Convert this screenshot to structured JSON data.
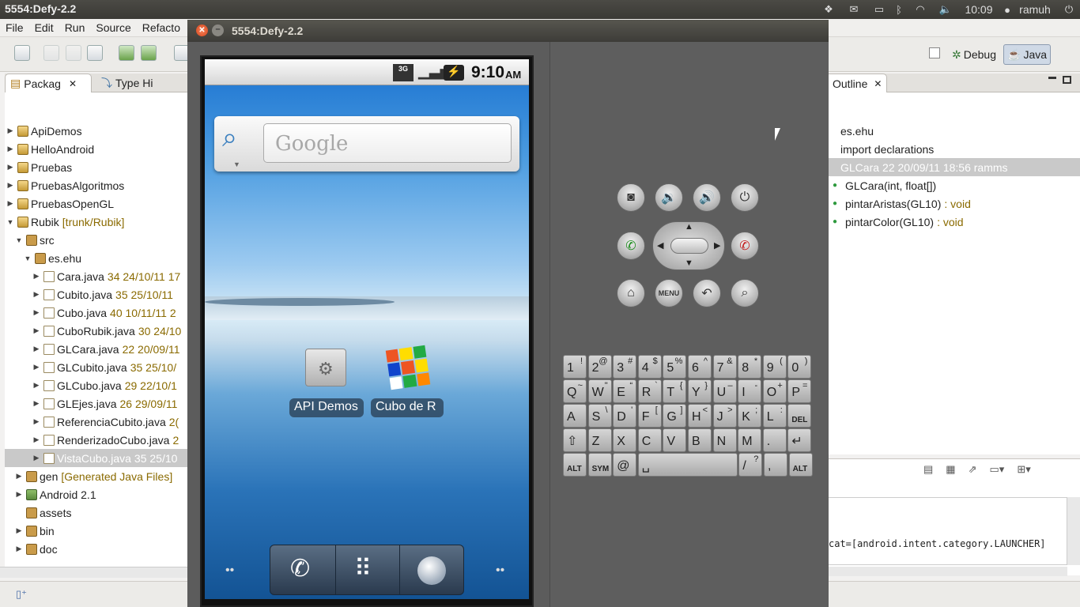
{
  "top_panel": {
    "window_title": "5554:Defy-2.2",
    "clock": "10:09",
    "user": "ramuh"
  },
  "menubar": {
    "items": [
      "File",
      "Edit",
      "Run",
      "Source",
      "Refacto"
    ]
  },
  "perspectives": {
    "debug": "Debug",
    "java": "Java"
  },
  "left_tabs": {
    "package": "Packag",
    "type_hierarchy": "Type Hi"
  },
  "package_tree": {
    "rows": [
      {
        "label": "ApiDemos",
        "deco": ""
      },
      {
        "label": "HelloAndroid",
        "deco": ""
      },
      {
        "label": "Pruebas",
        "deco": ""
      },
      {
        "label": "PruebasAlgoritmos",
        "deco": ""
      },
      {
        "label": "PruebasOpenGL",
        "deco": ""
      },
      {
        "label": "Rubik",
        "deco": "[trunk/Rubik]"
      },
      {
        "label": "src",
        "deco": ""
      },
      {
        "label": "es.ehu",
        "deco": ""
      },
      {
        "label": "Cara.java",
        "deco": "34  24/10/11 17"
      },
      {
        "label": "Cubito.java",
        "deco": "35  25/10/11"
      },
      {
        "label": "Cubo.java",
        "deco": "40  10/11/11 2"
      },
      {
        "label": "CuboRubik.java",
        "deco": "30  24/10"
      },
      {
        "label": "GLCara.java",
        "deco": "22  20/09/11"
      },
      {
        "label": "GLCubito.java",
        "deco": "35  25/10/"
      },
      {
        "label": "GLCubo.java",
        "deco": "29  22/10/1"
      },
      {
        "label": "GLEjes.java",
        "deco": "26  29/09/11"
      },
      {
        "label": "ReferenciaCubito.java",
        "deco": "2("
      },
      {
        "label": "RenderizadoCubo.java",
        "deco": "2"
      },
      {
        "label": "VistaCubo.java",
        "deco": "35  25/10"
      },
      {
        "label": "gen",
        "deco": "[Generated Java Files]"
      },
      {
        "label": "Android 2.1",
        "deco": ""
      },
      {
        "label": "assets",
        "deco": ""
      },
      {
        "label": "bin",
        "deco": ""
      },
      {
        "label": "doc",
        "deco": ""
      }
    ]
  },
  "outline": {
    "tab": "Outline",
    "rows": [
      {
        "label": "es.ehu",
        "deco": ""
      },
      {
        "label": "import declarations",
        "deco": ""
      },
      {
        "label": "GLCara",
        "deco": "22  20/09/11 18:56  ramms"
      },
      {
        "label": "GLCara(int, float[])",
        "deco": ""
      },
      {
        "label": "pintarAristas(GL10)",
        "deco": ": void"
      },
      {
        "label": "pintarColor(GL10)",
        "deco": ": void"
      }
    ]
  },
  "console": {
    "line": "cat=[android.intent.category.LAUNCHER]"
  },
  "emulator": {
    "title": "5554:Defy-2.2",
    "phone_time": "9:10",
    "phone_ampm": "AM",
    "network": "3G",
    "search_placeholder": "Google",
    "apps": [
      {
        "label": "API Demos"
      },
      {
        "label": "Cubo de R"
      }
    ],
    "keyboard": {
      "row1": [
        [
          "1",
          "!"
        ],
        [
          "2",
          "@"
        ],
        [
          "3",
          "#"
        ],
        [
          "4",
          "$"
        ],
        [
          "5",
          "%"
        ],
        [
          "6",
          "^"
        ],
        [
          "7",
          "&"
        ],
        [
          "8",
          "*"
        ],
        [
          "9",
          "("
        ],
        [
          "0",
          ")"
        ]
      ],
      "row2": [
        [
          "Q",
          "~"
        ],
        [
          "W",
          "\""
        ],
        [
          "E",
          "“"
        ],
        [
          "R",
          "`"
        ],
        [
          "T",
          "{"
        ],
        [
          "Y",
          "}"
        ],
        [
          "U",
          "–"
        ],
        [
          "I",
          "-"
        ],
        [
          "O",
          "+"
        ],
        [
          "P",
          "="
        ]
      ],
      "row3": [
        [
          "A",
          ""
        ],
        [
          "S",
          "\\"
        ],
        [
          "D",
          "'"
        ],
        [
          "F",
          "["
        ],
        [
          "G",
          "]"
        ],
        [
          "H",
          "<"
        ],
        [
          "J",
          ">"
        ],
        [
          "K",
          ";"
        ],
        [
          "L",
          ":"
        ],
        [
          "DEL",
          ""
        ]
      ],
      "row4": [
        [
          "⇧",
          ""
        ],
        [
          "Z",
          ""
        ],
        [
          "X",
          ""
        ],
        [
          "C",
          ""
        ],
        [
          "V",
          ""
        ],
        [
          "B",
          ""
        ],
        [
          "N",
          ""
        ],
        [
          "M",
          ""
        ],
        [
          ".",
          ""
        ],
        [
          "↵",
          ""
        ]
      ],
      "row5": [
        [
          "ALT",
          ""
        ],
        [
          "SYM",
          ""
        ],
        [
          "@",
          ""
        ],
        [
          "␣",
          ""
        ],
        [
          "/",
          "?"
        ],
        [
          ",",
          ""
        ],
        [
          "ALT",
          ""
        ]
      ]
    },
    "keys_menu_label": "MENU"
  }
}
